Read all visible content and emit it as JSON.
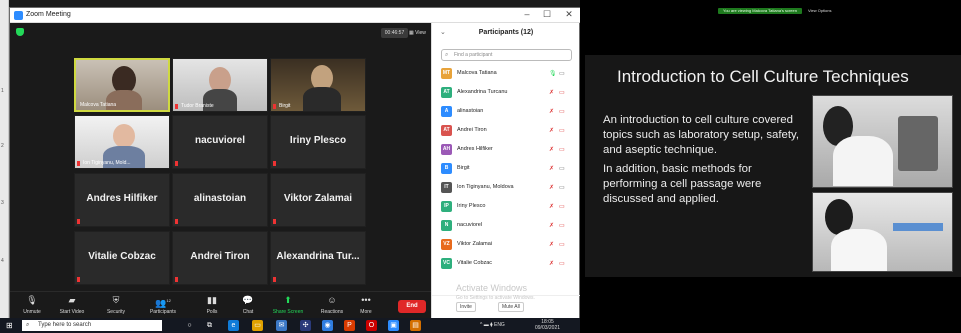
{
  "window": {
    "title": "Zoom Meeting",
    "controls": [
      "–",
      "☐",
      "✕"
    ]
  },
  "meeting": {
    "timer": "00:46:57",
    "view_label": "View"
  },
  "tiles": [
    {
      "name": "Malcova Tatiana",
      "label": "Malcova Tatiana",
      "kind": "video"
    },
    {
      "name": "Tudor Braniste",
      "label": "Tudor Braniste",
      "kind": "video"
    },
    {
      "name": "Birgit",
      "label": "Birgit",
      "kind": "video"
    },
    {
      "name": "Ion Tiginyanu, Mold...",
      "label": "Ion Tiginyanu, Mold...",
      "kind": "video"
    },
    {
      "name": "nacuviorel",
      "label": "",
      "kind": "name"
    },
    {
      "name": "Iriny Plesco",
      "label": "",
      "kind": "name"
    },
    {
      "name": "Andres Hilfiker",
      "label": "",
      "kind": "name"
    },
    {
      "name": "alinastoian",
      "label": "",
      "kind": "name"
    },
    {
      "name": "Viktor Zalamai",
      "label": "",
      "kind": "name"
    },
    {
      "name": "Vitalie Cobzac",
      "label": "",
      "kind": "name"
    },
    {
      "name": "Andrei Tiron",
      "label": "",
      "kind": "name"
    },
    {
      "name": "Alexandrina Tur...",
      "label": "",
      "kind": "name"
    }
  ],
  "toolbar": {
    "unmute": "Unmute",
    "start_video": "Start Video",
    "security": "Security",
    "participants": "Participants",
    "participants_count": "12",
    "polls": "Polls",
    "chat": "Chat",
    "share_screen": "Share Screen",
    "reactions": "Reactions",
    "more": "More",
    "end": "End"
  },
  "participants_panel": {
    "title": "Participants (12)",
    "search_placeholder": "Find a participant",
    "list": [
      {
        "initials": "MT",
        "name": "Malcova Tatiana",
        "color": "#e8a33a"
      },
      {
        "initials": "AT",
        "name": "Alexandrina Turcanu",
        "color": "#2eaf7d"
      },
      {
        "initials": "A",
        "name": "alinastoian",
        "color": "#2d8cff"
      },
      {
        "initials": "AT",
        "name": "Andrei Tiron",
        "color": "#d9534f"
      },
      {
        "initials": "AH",
        "name": "Andres Hilfiker",
        "color": "#9b59b6"
      },
      {
        "initials": "B",
        "name": "Birgit",
        "color": "#2d8cff"
      },
      {
        "initials": "IT",
        "name": "Ion Tiginyanu, Moldova",
        "color": "#555555"
      },
      {
        "initials": "IP",
        "name": "Iriny Plesco",
        "color": "#2eaf7d"
      },
      {
        "initials": "N",
        "name": "nacuviorel",
        "color": "#2eaf7d"
      },
      {
        "initials": "VZ",
        "name": "Viktor Zalamai",
        "color": "#e86a1c"
      },
      {
        "initials": "VC",
        "name": "Vitalie Cobzac",
        "color": "#2eaf7d"
      }
    ],
    "invite": "Invite",
    "mute_all": "Mute All"
  },
  "activation": {
    "title": "Activate Windows",
    "subtitle": "Go to Settings to activate Windows."
  },
  "taskbar": {
    "search_placeholder": "Type here to search",
    "lang": "ENG",
    "time": "18:05",
    "date": "09/03/2021"
  },
  "share_bar": {
    "status": "You are viewing Malcova Tatiana's screen",
    "view_options": "View Options"
  },
  "slide": {
    "title": "Introduction to Cell Culture Techniques",
    "paragraph1": "An introduction to cell culture covered topics such as laboratory setup, safety, and aseptic technique.",
    "paragraph2": "In addition, basic methods for performing a cell passage were discussed and applied."
  },
  "left_strip_rows": [
    "1",
    "2",
    "3",
    "4"
  ]
}
